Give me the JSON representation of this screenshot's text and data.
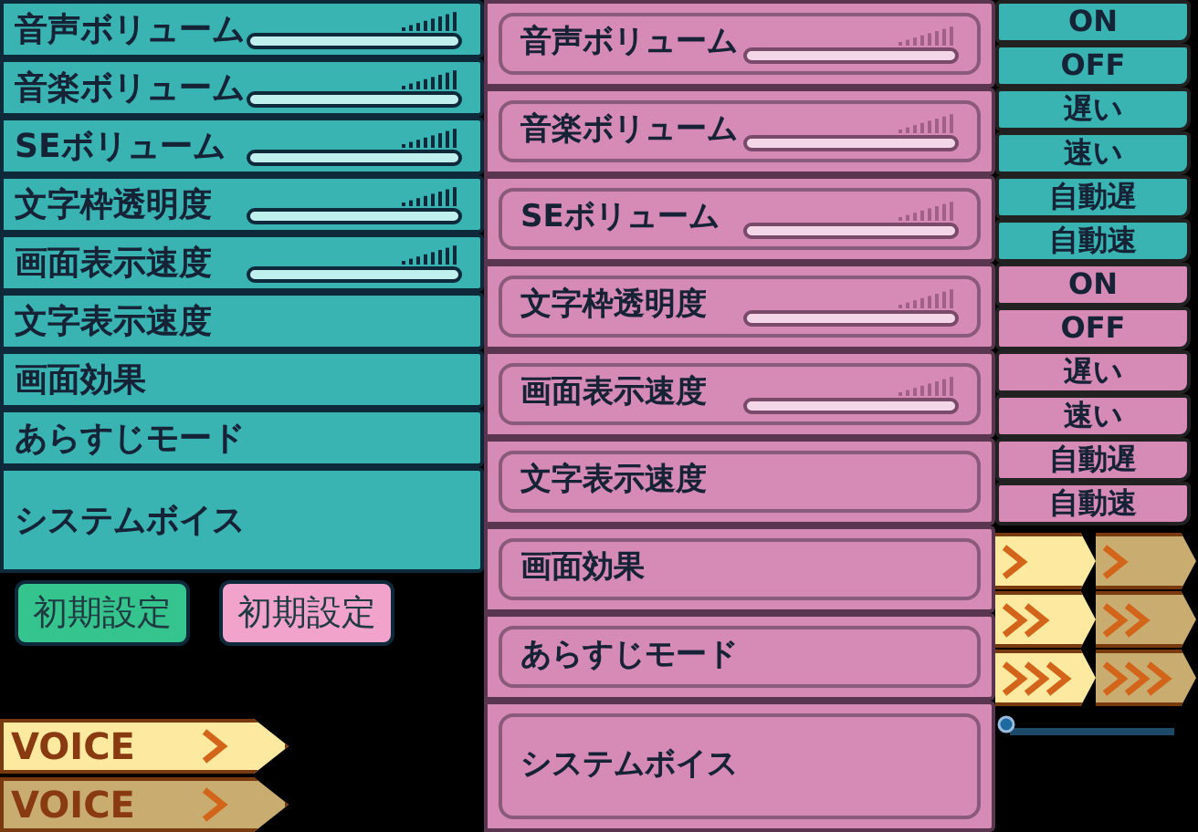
{
  "left_panel": {
    "rows": [
      {
        "label": "音声ボリューム",
        "kind": "slider"
      },
      {
        "label": "音楽ボリューム",
        "kind": "slider"
      },
      {
        "label": "SEボリューム",
        "kind": "slider"
      },
      {
        "label": "文字枠透明度",
        "kind": "slider"
      },
      {
        "label": "画面表示速度",
        "kind": "slider"
      },
      {
        "label": "文字表示速度",
        "kind": "plain"
      },
      {
        "label": "画面効果",
        "kind": "plain"
      },
      {
        "label": "あらすじモード",
        "kind": "plain"
      },
      {
        "label": "システムボイス",
        "kind": "tall"
      }
    ]
  },
  "reset_buttons": [
    {
      "label": "初期設定"
    },
    {
      "label": "初期設定"
    }
  ],
  "voice_tabs": [
    {
      "label": "VOICE"
    },
    {
      "label": "VOICE"
    }
  ],
  "middle_panel": {
    "rows": [
      {
        "label": "音声ボリューム",
        "kind": "slider"
      },
      {
        "label": "音楽ボリューム",
        "kind": "slider"
      },
      {
        "label": "SEボリューム",
        "kind": "slider"
      },
      {
        "label": "文字枠透明度",
        "kind": "slider"
      },
      {
        "label": "画面表示速度",
        "kind": "slider"
      },
      {
        "label": "文字表示速度",
        "kind": "plain"
      },
      {
        "label": "画面効果",
        "kind": "plain"
      },
      {
        "label": "あらすじモード",
        "kind": "plain"
      },
      {
        "label": "システムボイス",
        "kind": "tall"
      }
    ]
  },
  "option_buttons": [
    {
      "label": "ON"
    },
    {
      "label": "OFF"
    },
    {
      "label": "遅い"
    },
    {
      "label": "速い"
    },
    {
      "label": "自動遅"
    },
    {
      "label": "自動速"
    },
    {
      "label": "ON"
    },
    {
      "label": "OFF"
    },
    {
      "label": "遅い"
    },
    {
      "label": "速い"
    },
    {
      "label": "自動遅"
    },
    {
      "label": "自動速"
    }
  ],
  "arrow_buttons": [
    {
      "kind": "single"
    },
    {
      "kind": "single"
    },
    {
      "kind": "double"
    },
    {
      "kind": "double"
    },
    {
      "kind": "triple"
    },
    {
      "kind": "triple"
    }
  ]
}
